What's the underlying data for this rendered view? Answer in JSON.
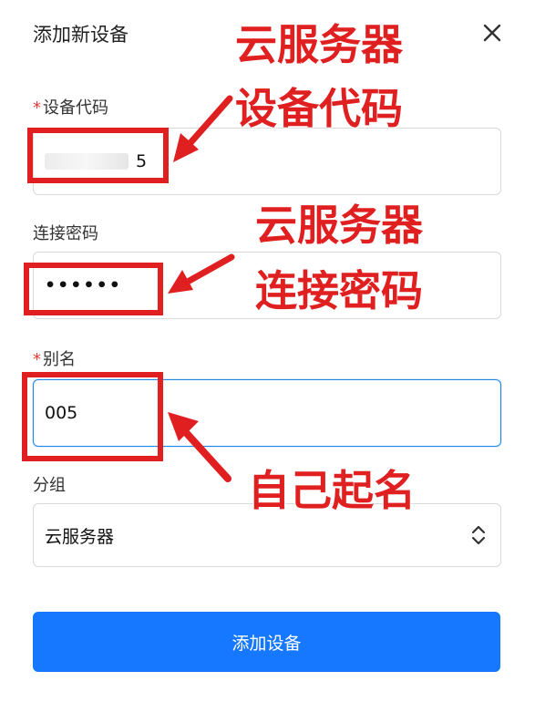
{
  "dialog": {
    "title": "添加新设备",
    "close_icon": "close-icon"
  },
  "form": {
    "device_code": {
      "label": "设备代码",
      "required": true,
      "value_visible": "5"
    },
    "password": {
      "label": "连接密码",
      "value_masked": "••••••"
    },
    "alias": {
      "label": "别名",
      "required": true,
      "value": "005"
    },
    "group": {
      "label": "分组",
      "selected": "云服务器",
      "icon": "updown-chevron-icon"
    },
    "submit_label": "添加设备"
  },
  "annotations": {
    "note1_line1": "云服务器",
    "note1_line2": "设备代码",
    "note2_line1": "云服务器",
    "note2_line2": "连接密码",
    "note3": "自己起名",
    "color": "#e02020"
  },
  "colors": {
    "primary": "#1677ff",
    "required": "#e53935",
    "focus": "#1e88e5"
  }
}
